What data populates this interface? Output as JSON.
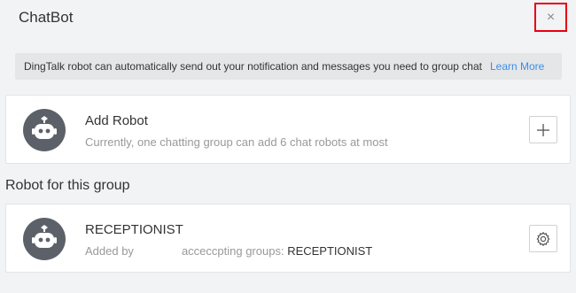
{
  "window": {
    "title": "ChatBot",
    "close_glyph": "×"
  },
  "banner": {
    "text": "DingTalk robot can automatically send out your notification and messages you need to group chat",
    "link": "Learn More"
  },
  "add_robot": {
    "title": "Add Robot",
    "subtitle": "Currently, one chatting group can add 6 chat robots at most",
    "icon": "plus-icon"
  },
  "section": {
    "title": "Robot for this group"
  },
  "robots": [
    {
      "name": "RECEPTIONIST",
      "added_by_label": "Added by",
      "groups_label": "acceccpting groups:",
      "groups_value": "RECEPTIONIST",
      "icon": "gear-icon"
    }
  ],
  "colors": {
    "accent_link": "#3e8ee6",
    "highlight_border": "#e60012",
    "avatar_bg": "#5c6169"
  }
}
